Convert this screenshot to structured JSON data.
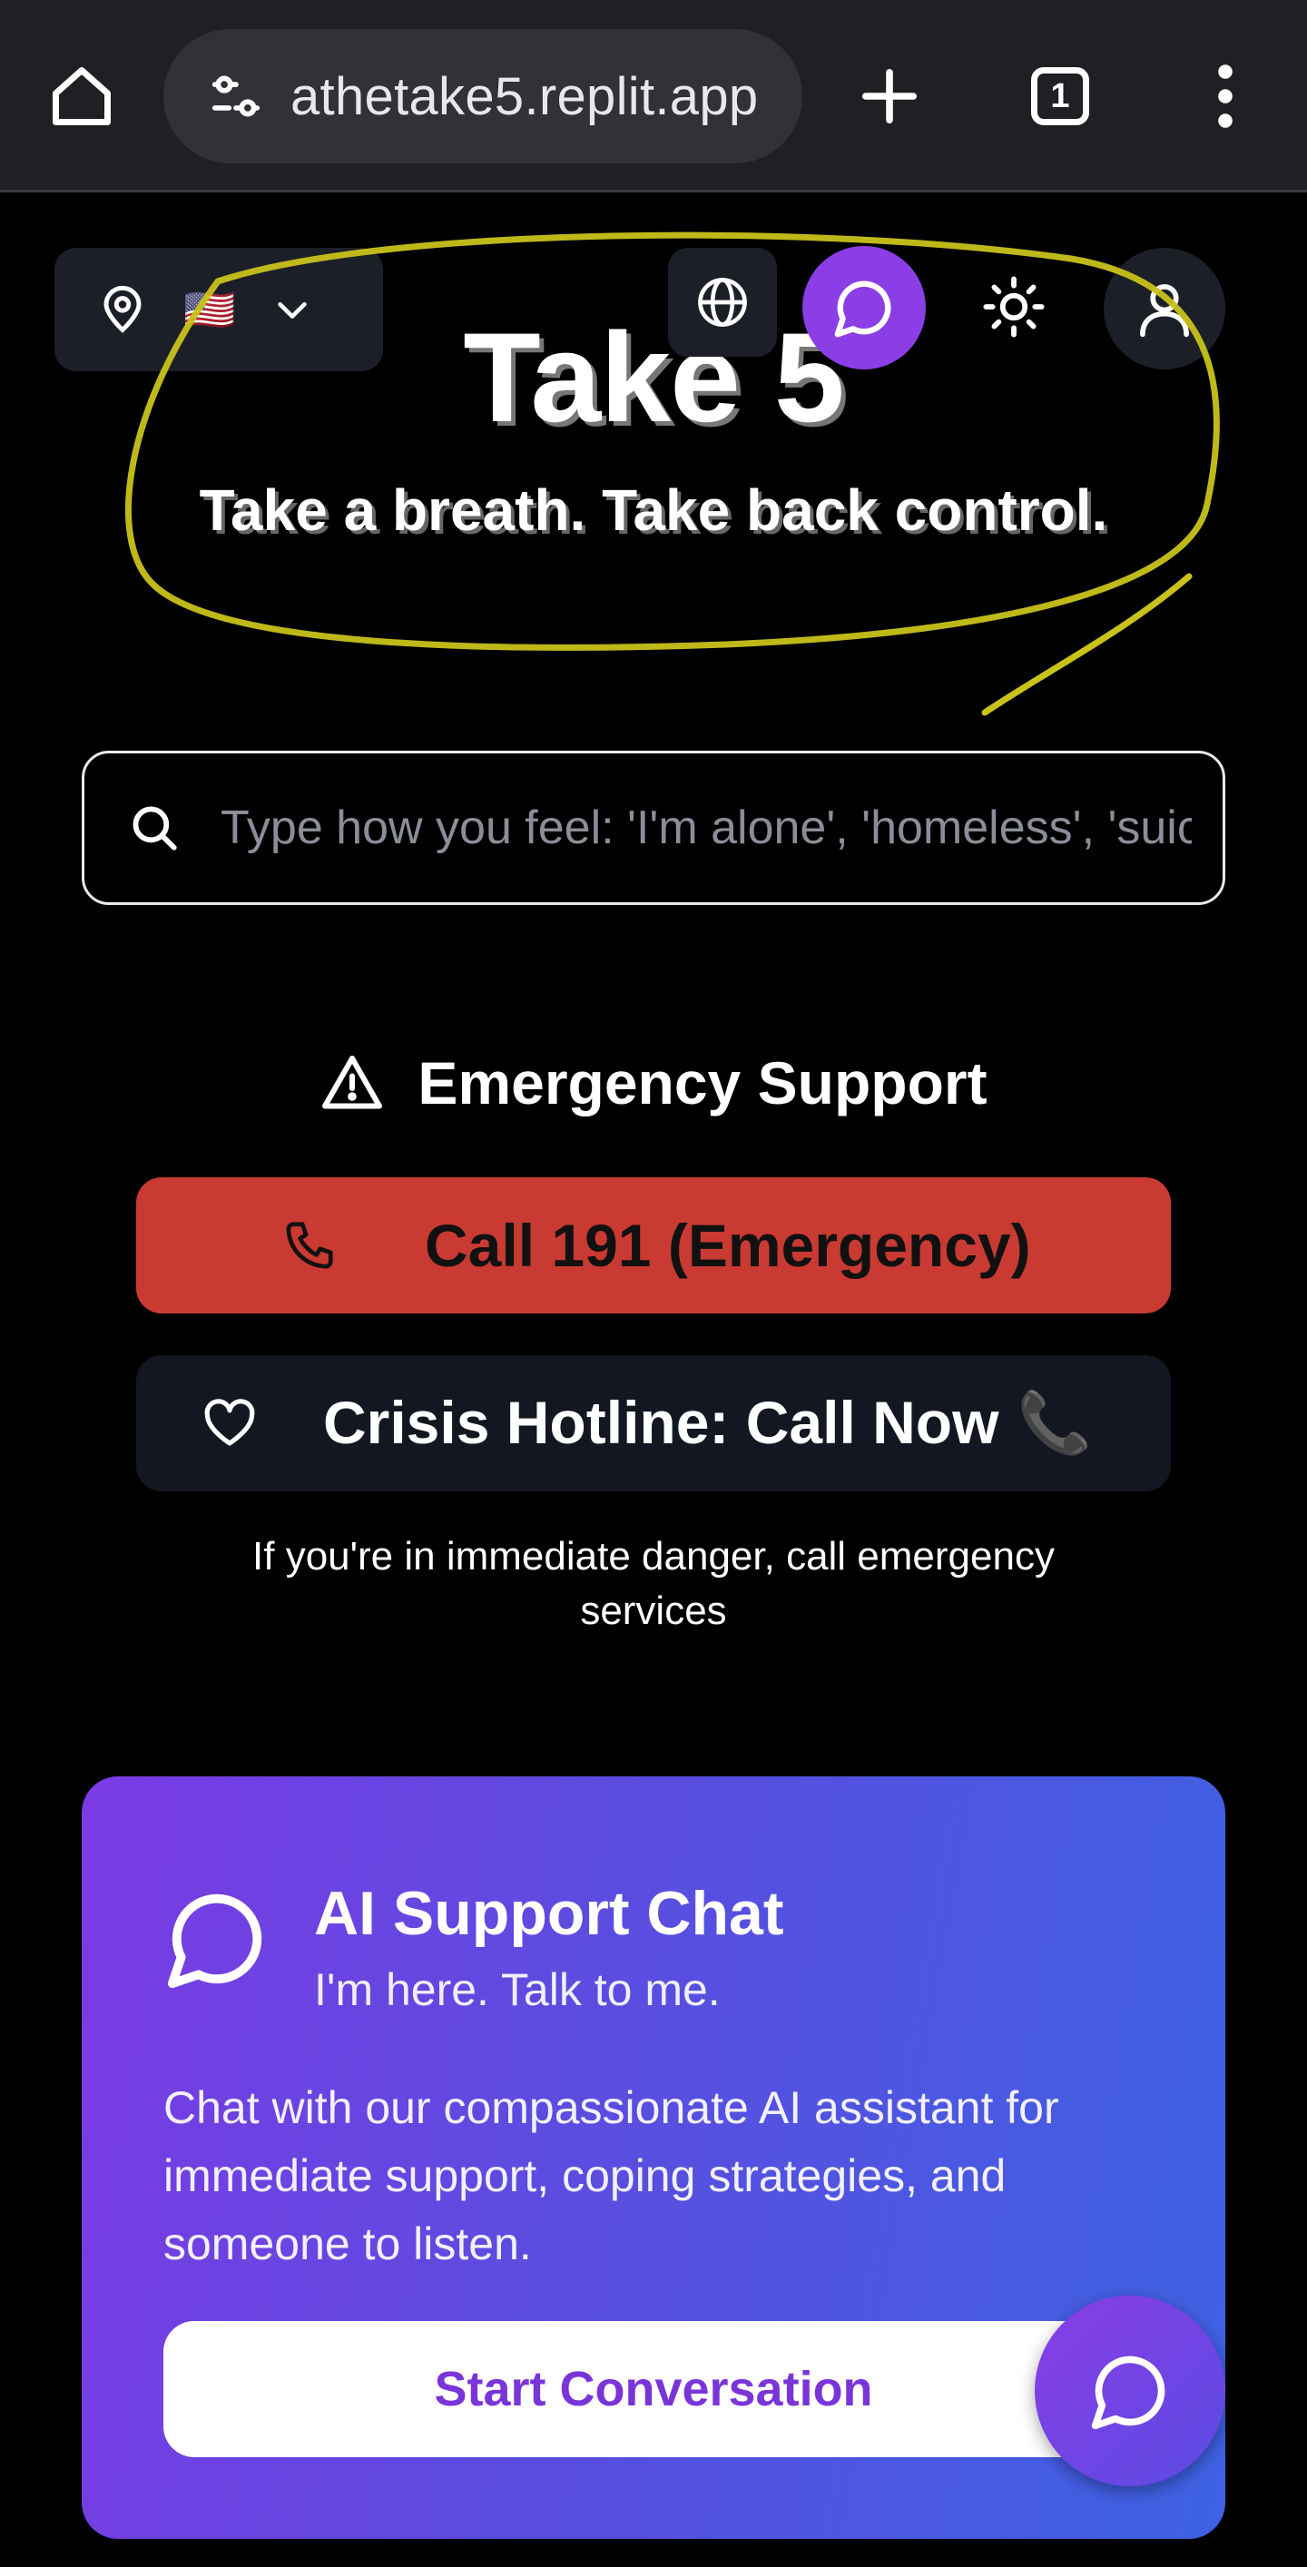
{
  "browser": {
    "url": "athetake5.replit.app",
    "tab_count": "1",
    "icons": [
      "home-icon",
      "site-info-icon",
      "plus-icon",
      "tab-switcher-icon",
      "more-vert-icon"
    ]
  },
  "header": {
    "location_flag": "🇺🇸",
    "icons": [
      "map-pin-icon",
      "chevron-down-icon",
      "globe-icon",
      "chat-bubble-icon",
      "sun-icon",
      "user-icon"
    ]
  },
  "hero": {
    "title": "Take 5",
    "subtitle": "Take a breath. Take back control."
  },
  "search": {
    "placeholder": "Type how you feel: 'I'm alone', 'homeless', 'suicidal', 'anxious'...",
    "value": ""
  },
  "emergency": {
    "heading": "Emergency Support",
    "call_label": "Call 191 (Emergency)",
    "hotline_label": "Crisis Hotline: Call Now",
    "hotline_emoji": "📞",
    "note": "If you're in immediate danger, call emergency services"
  },
  "ai_card": {
    "title": "AI Support Chat",
    "subtitle": "I'm here. Talk to me.",
    "description": "Chat with our compassionate AI assistant for immediate support, coping strategies, and someone to listen.",
    "button_label": "Start Conversation"
  },
  "colors": {
    "accent_purple": "#8b3ee6",
    "emergency_red": "#c93a32",
    "card_gradient_start": "#7b3be3",
    "card_gradient_end": "#3d62e3",
    "annotation_yellow": "#c9c21a"
  }
}
